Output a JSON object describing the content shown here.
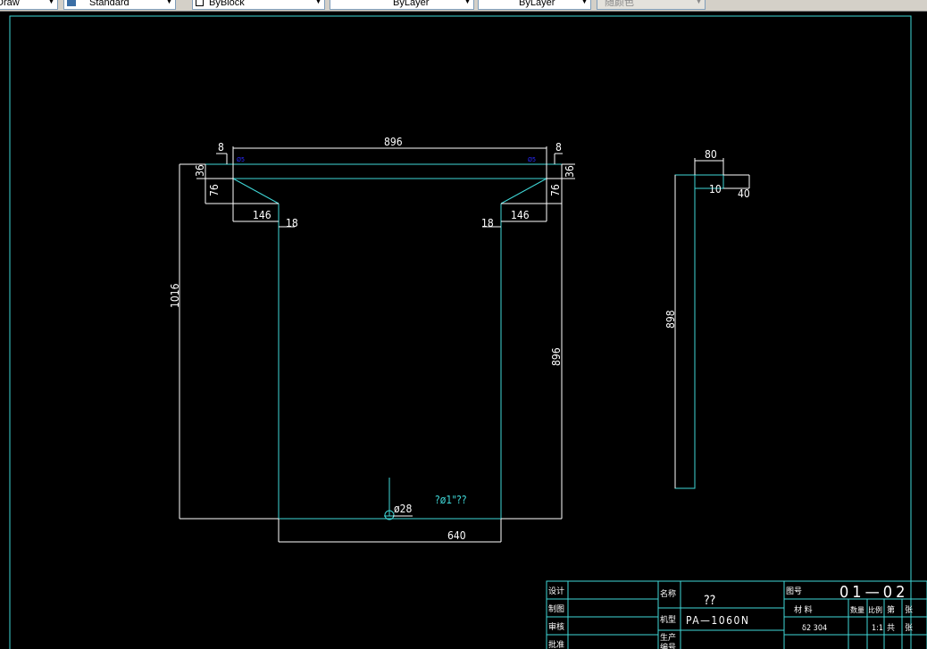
{
  "toolbar": {
    "layer_text": "Draw",
    "textstyle_text": "Standard",
    "color_text": "ByBlock",
    "linetype_text": "ByLayer",
    "lineweight_text": "ByLayer",
    "plotstyle_text": "随颜色"
  },
  "colors": {
    "background": "#000000",
    "cyan": "#3fd7d7",
    "white": "#ffffff",
    "blue": "#2a2aff"
  },
  "dims": {
    "top_width": "896",
    "top_left_inset": "8",
    "top_right_inset": "8",
    "left_36": "36",
    "right_36": "36",
    "left_76": "76",
    "right_76": "76",
    "left_146": "146",
    "right_146": "146",
    "left_18": "18",
    "right_18": "18",
    "left_height": "1016",
    "right_height": "896",
    "bottom_width": "640",
    "hole_dia": "ø28",
    "note": "?ø1\"??",
    "side_width": "80",
    "side_10": "10",
    "side_40": "40",
    "side_height": "898"
  },
  "titleblock": {
    "design": "设计",
    "draw": "制图",
    "review": "审核",
    "approve": "批准",
    "name_label": "名称",
    "name_value": "??",
    "model_label": "机型",
    "model_value": "PA—1060N",
    "prod_label": "生产",
    "prod_label2": "编号",
    "drawing_no_label": "图号",
    "drawing_no": "01—02",
    "material_label": "材   料",
    "qty_label": "数量",
    "scale_label": "比例",
    "sheet_label": "第",
    "sheet_label2": "张",
    "material_value": "δ2  304",
    "scale_value": "1:1",
    "total_label": "共",
    "total_label2": "张"
  }
}
